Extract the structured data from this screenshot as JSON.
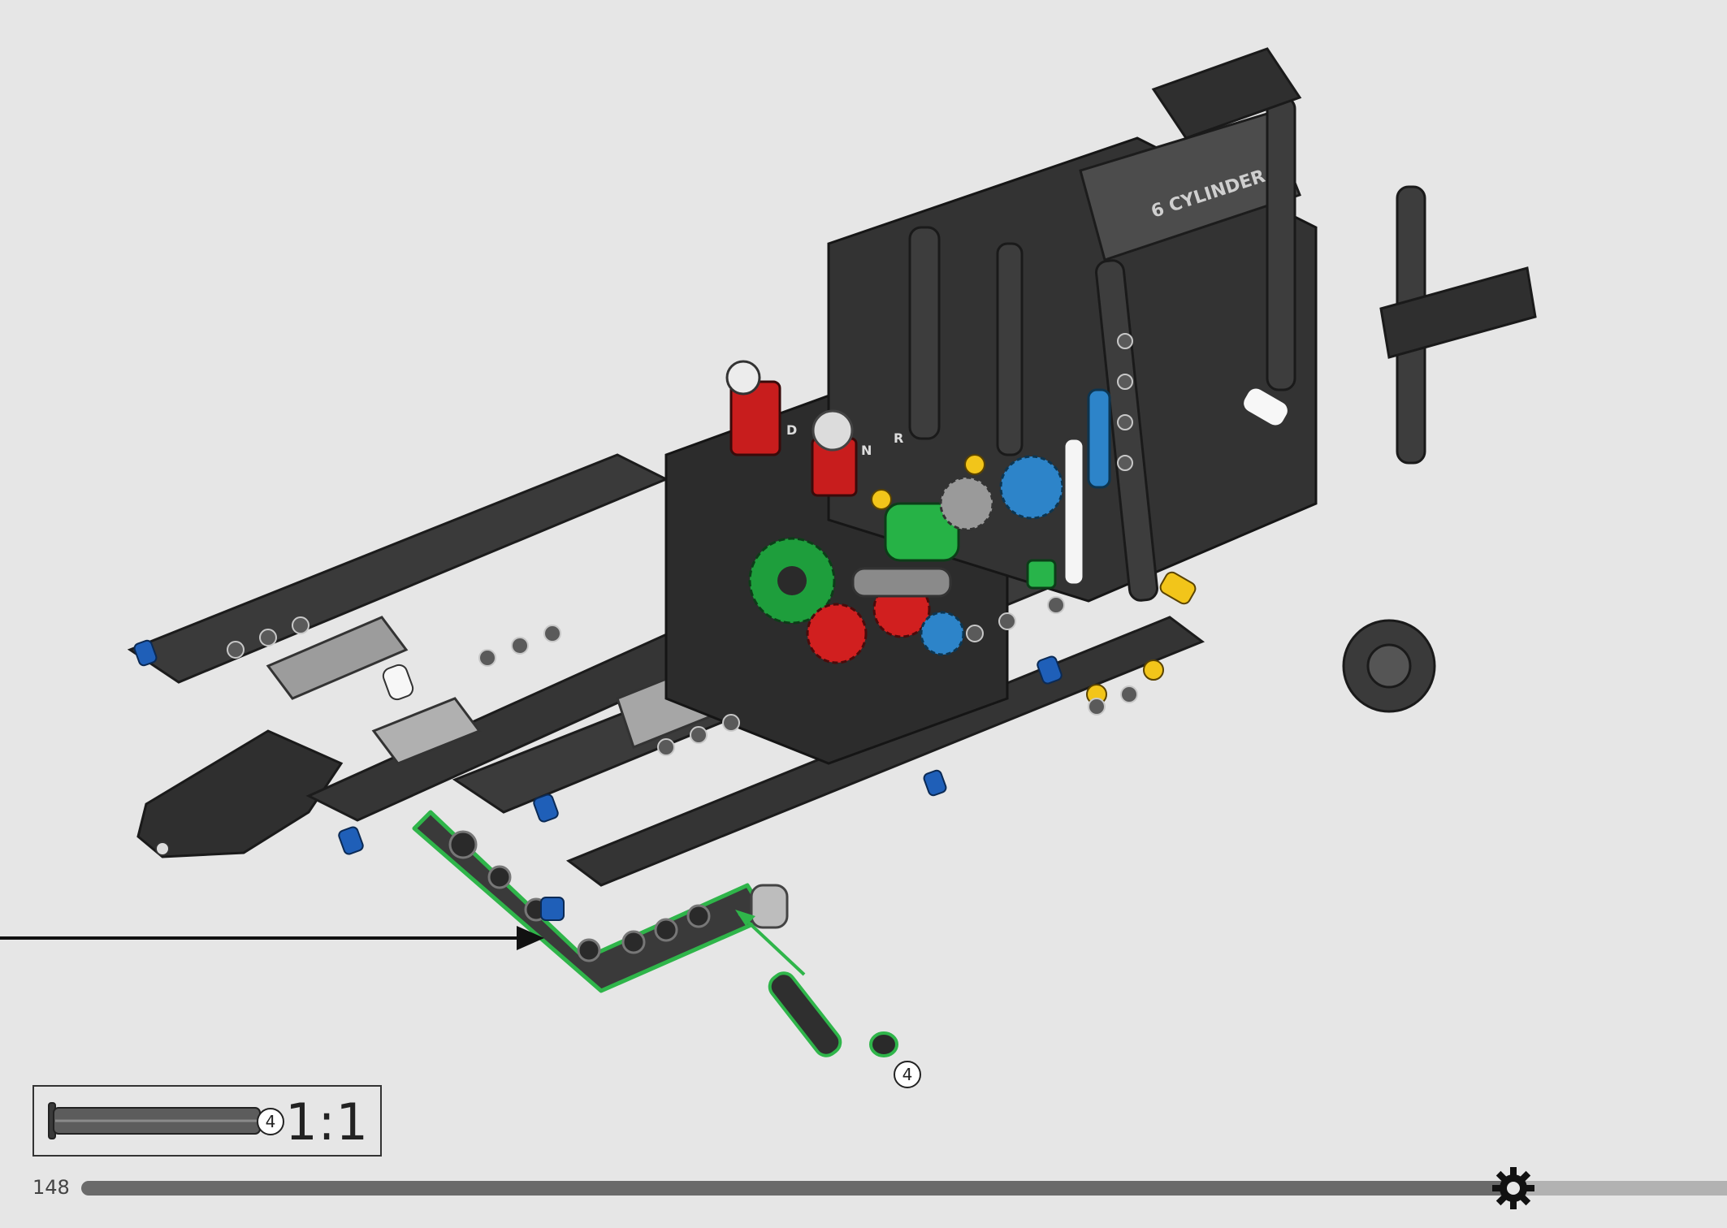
{
  "model": {
    "engine_label": "6 CYLINDER",
    "selector_labels": [
      "D",
      "N",
      "R"
    ]
  },
  "callout": {
    "quantity": "4"
  },
  "scale_box": {
    "quantity": "4",
    "ratio": "1:1"
  },
  "footer": {
    "page_number": "148",
    "progress": 0.87,
    "marker_icon": "gear-icon"
  },
  "colors": {
    "background": "#e6e6e6",
    "highlight": "#2fb54a",
    "progress_done": "#6a6a6a",
    "progress_remaining": "#b2b2b2",
    "beam_dark": "#3a3a3a",
    "beam_light": "#9a9a9a",
    "pin_blue": "#1f5fb8",
    "gear_green": "#1e9e3c",
    "gear_red": "#d11f1f",
    "axle_yellow": "#f2c51a"
  }
}
